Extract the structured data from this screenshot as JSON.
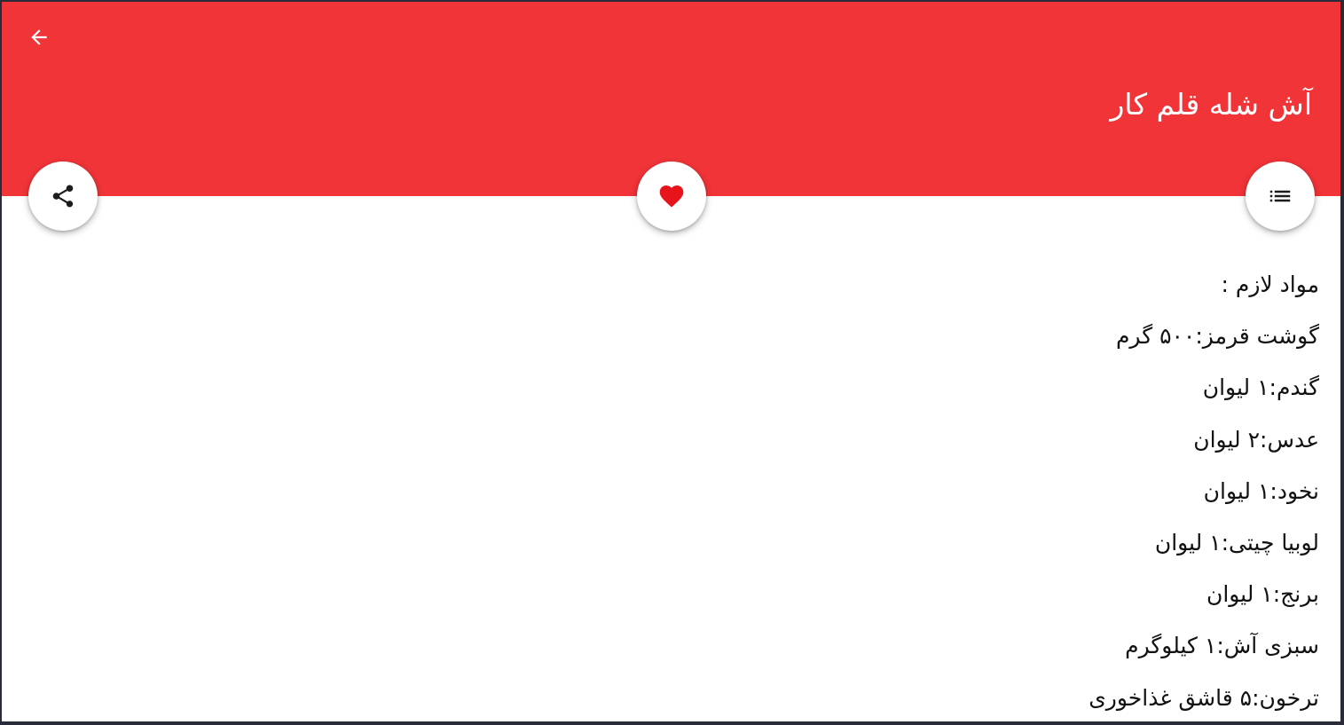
{
  "header": {
    "title": "آش شله قلم کار",
    "background_color": "#f03438",
    "back_icon": "arrow-left-icon"
  },
  "actions": {
    "share_icon": "share-icon",
    "favorite_icon": "heart-icon",
    "favorite_color": "#e8141b",
    "list_icon": "list-icon"
  },
  "content": {
    "heading": "مواد لازم :",
    "ingredients": [
      "گوشت قرمز:۵۰۰ گرم",
      "گندم:۱ لیوان",
      "عدس:۲ لیوان",
      "نخود:۱ لیوان",
      "لوبیا چیتی:۱ لیوان",
      "برنج:۱ لیوان",
      "سبزی آش:۱ کیلوگرم",
      "ترخون:۵ قاشق غذاخوری"
    ]
  }
}
